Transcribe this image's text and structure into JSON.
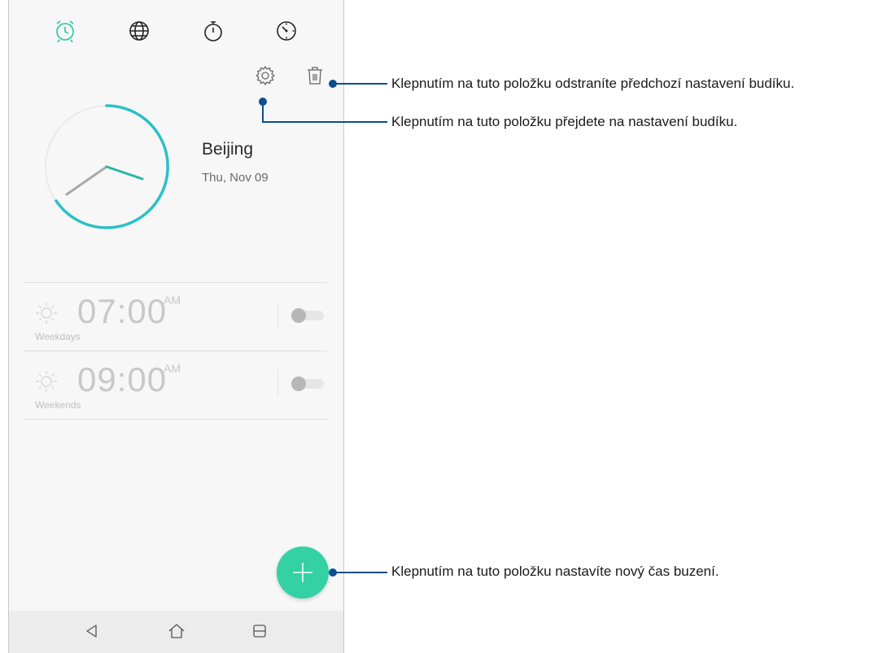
{
  "tabs": [
    {
      "name": "alarm-tab",
      "icon": "alarm-clock-icon",
      "active": true
    },
    {
      "name": "world-clock-tab",
      "icon": "globe-icon",
      "active": false
    },
    {
      "name": "stopwatch-tab",
      "icon": "stopwatch-icon",
      "active": false
    },
    {
      "name": "timer-tab",
      "icon": "timer-icon",
      "active": false
    }
  ],
  "actions": {
    "settings_icon": "gear-icon",
    "delete_icon": "trash-icon"
  },
  "clock": {
    "city": "Beijing",
    "date": "Thu, Nov 09"
  },
  "alarms": [
    {
      "time": "07:00",
      "ampm": "AM",
      "repeat": "Weekdays",
      "enabled": false
    },
    {
      "time": "09:00",
      "ampm": "AM",
      "repeat": "Weekends",
      "enabled": false
    }
  ],
  "fab": {
    "icon": "plus-icon"
  },
  "nav": [
    "back-icon",
    "home-icon",
    "recents-icon"
  ],
  "callouts": {
    "delete": "Klepnutím na tuto položku odstraníte předchozí nastavení budíku.",
    "settings": "Klepnutím na tuto položku přejdete na nastavení budíku.",
    "add": "Klepnutím na tuto položku nastavíte nový čas buzení."
  },
  "colors": {
    "accent": "#33d1a4",
    "clock_ring": "#2ac0c8",
    "callout": "#0d4e8f"
  }
}
